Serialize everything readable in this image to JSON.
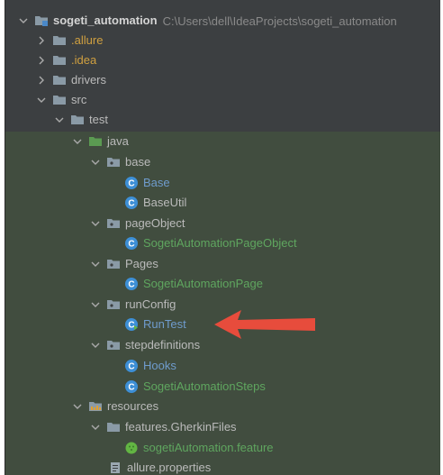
{
  "colors": {
    "panel_bg": "#3c3f41",
    "test_scope_bg": "#414d3f",
    "folder_icon": "#8a9aa6",
    "java_class_icon": "#3d8fd6",
    "feature_icon": "#62b543",
    "arrow": "#e74c3c"
  },
  "tree": {
    "root": {
      "name": "sogeti_automation",
      "path": "C:\\Users\\dell\\IdeaProjects\\sogeti_automation"
    },
    "allure": "allure",
    "idea": ".idea",
    "drivers": "drivers",
    "src": "src",
    "test": "test",
    "java": "java",
    "base": "base",
    "base_class": "Base",
    "baseutil_class": "BaseUtil",
    "pageobject": "pageObject",
    "pageobject_class": "SogetiAutomationPageObject",
    "pages": "Pages",
    "pages_class": "SogetiAutomationPage",
    "runconfig": "runConfig",
    "runtest_class": "RunTest",
    "stepdefinitions": "stepdefinitions",
    "hooks_class": "Hooks",
    "steps_class": "SogetiAutomationSteps",
    "resources": "resources",
    "features": "features.GherkinFiles",
    "feature_file": "sogetiAutomation.feature",
    "allure_properties": "allure.properties"
  }
}
